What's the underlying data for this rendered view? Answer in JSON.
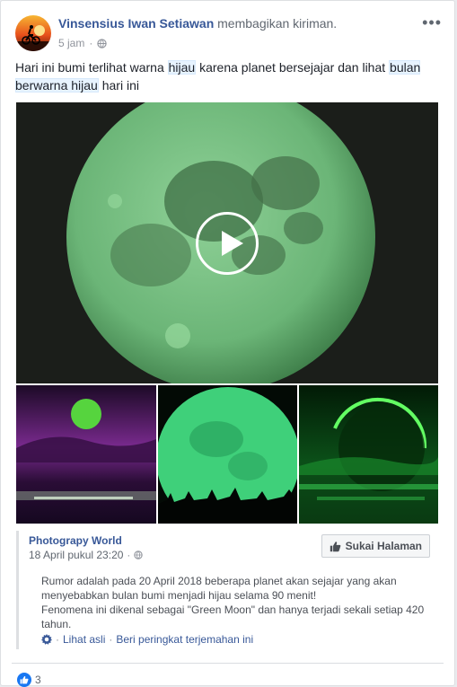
{
  "post": {
    "author": "Vinsensius Iwan Setiawan",
    "verb": "membagikan kiriman.",
    "time": "5 jam",
    "text_parts": {
      "p1": "Hari ini bumi terlihat warna ",
      "h1": "hijau",
      "p2": " karena planet bersejajar dan lihat ",
      "h2": "bulan berwarna hijau",
      "p3": " hari ini"
    },
    "more_icon": "more-horizontal-icon",
    "privacy_icon": "globe-icon"
  },
  "shared": {
    "page_name": "Photograpy World",
    "date": "18 April pukul 23:20",
    "like_button": "Sukai Halaman",
    "text_lines": [
      "Rumor adalah pada 20 April 2018 beberapa planet akan sejajar yang akan menyebabkan bulan bumi menjadi hijau selama 90 menit!",
      "Fenomena ini dikenal sebagai \"Green Moon\" dan hanya terjadi sekali setiap 420 tahun."
    ],
    "see_original": "Lihat asli",
    "rate_translation": "Beri peringkat terjemahan ini",
    "sep": "·"
  },
  "reactions": {
    "count": "3",
    "icon": "like-icon"
  },
  "colors": {
    "link": "#385898",
    "accent": "#1877f2"
  }
}
